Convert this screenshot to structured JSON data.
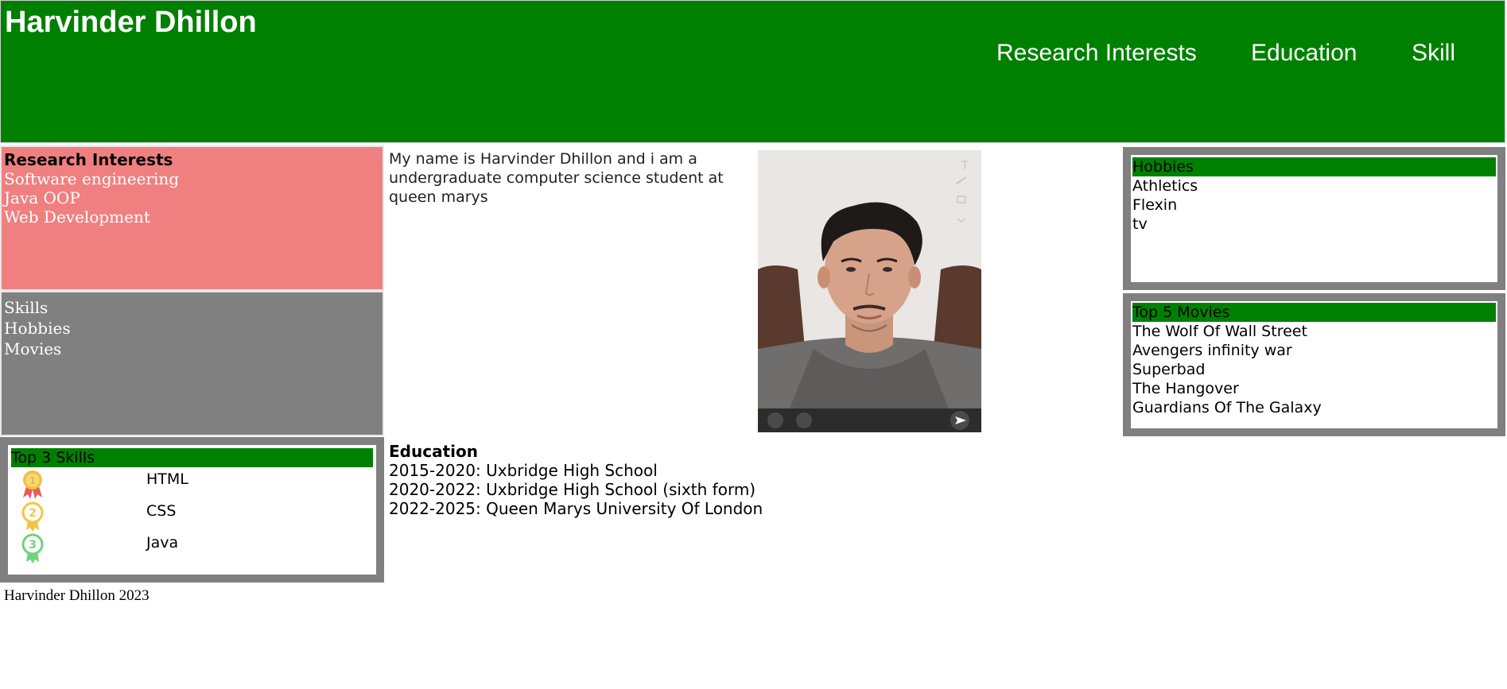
{
  "header": {
    "title": "Harvinder Dhillon",
    "nav": [
      "Research Interests",
      "Education",
      "Skill"
    ]
  },
  "research_interests": {
    "title": "Research Interests",
    "items": [
      "Software engineering",
      "Java OOP",
      "Web Development"
    ]
  },
  "links": {
    "items": [
      "Skills",
      "Hobbies",
      "Movies"
    ]
  },
  "top_skills": {
    "title": "Top 3 Skills",
    "items": [
      {
        "rank": "1",
        "name": "HTML",
        "color": "#f2c046"
      },
      {
        "rank": "2",
        "name": "CSS",
        "color": "#f5c542"
      },
      {
        "rank": "3",
        "name": "Java",
        "color": "#6fd37a"
      }
    ]
  },
  "about": {
    "text": "My name is Harvinder Dhillon and i am a undergraduate computer science student at queen marys"
  },
  "education": {
    "title": "Education",
    "items": [
      "2015-2020: Uxbridge High School",
      "2020-2022: Uxbridge High School (sixth form)",
      "2022-2025: Queen Marys University Of London"
    ]
  },
  "hobbies": {
    "title": "Hobbies",
    "items": [
      "Athletics",
      "Flexin",
      "tv"
    ]
  },
  "movies": {
    "title": "Top 5 Movies",
    "items": [
      "The Wolf Of Wall Street",
      "Avengers infinity war",
      "Superbad",
      "The Hangover",
      "Guardians Of The Galaxy"
    ]
  },
  "footer": {
    "text": "Harvinder Dhillon 2023"
  },
  "colors": {
    "header_bg": "#008000",
    "research_bg": "#f08080",
    "panel_grey": "#808080"
  }
}
